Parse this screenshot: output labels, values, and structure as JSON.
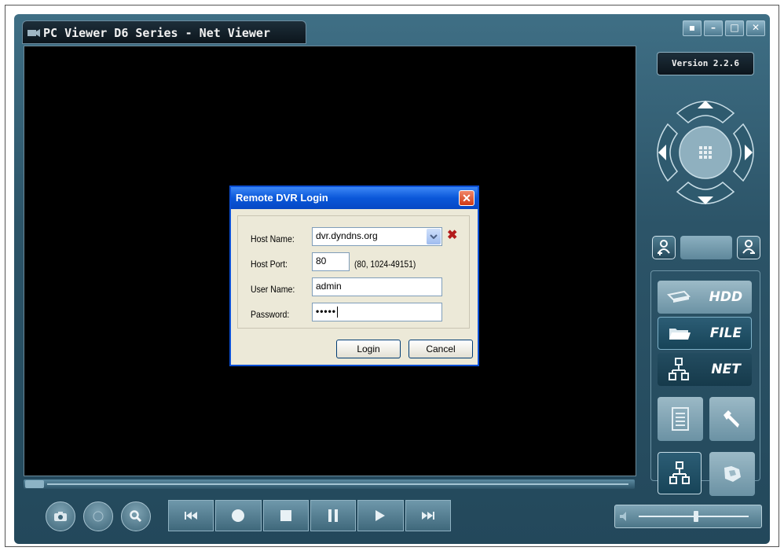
{
  "window": {
    "title": "PC Viewer D6 Series - Net Viewer",
    "controls": [
      "restore-icon",
      "minimize-icon",
      "maximize-icon",
      "close-icon"
    ]
  },
  "side_panel": {
    "version": "Version 2.2.6",
    "modes": [
      {
        "label": "HDD",
        "icon": "hdd-icon"
      },
      {
        "label": "FILE",
        "icon": "folder-icon"
      },
      {
        "label": "NET",
        "icon": "network-icon"
      }
    ]
  },
  "dialog": {
    "title": "Remote DVR Login",
    "host_name": {
      "label": "Host Name:",
      "value": "dvr.dyndns.org"
    },
    "host_port": {
      "label": "Host Port:",
      "value": "80",
      "hint": "(80, 1024-49151)"
    },
    "user_name": {
      "label": "User Name:",
      "value": "admin"
    },
    "password": {
      "label": "Password:",
      "value": "•••••"
    },
    "login_label": "Login",
    "cancel_label": "Cancel"
  },
  "colors": {
    "frame": "#2c5468",
    "dialog_title": "#0a57d9",
    "dialog_bg": "#ece9d8",
    "video": "#000000"
  }
}
